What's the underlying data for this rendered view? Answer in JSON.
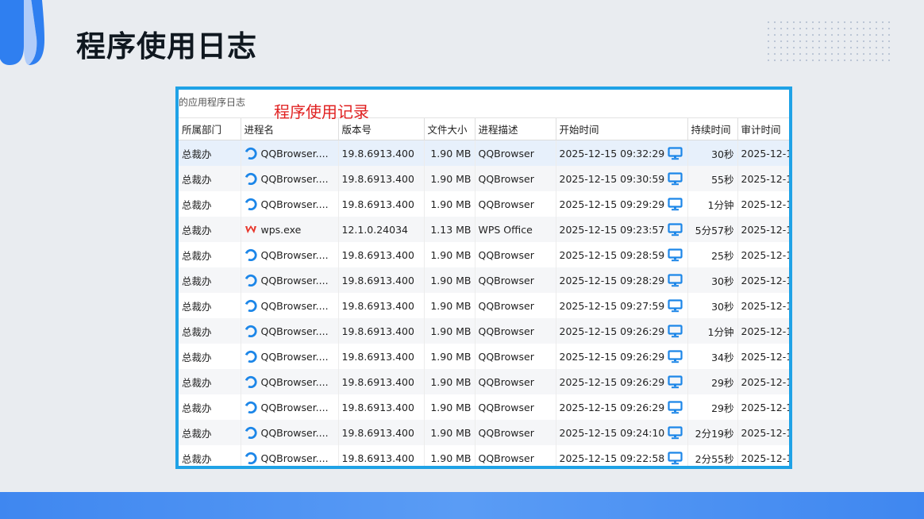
{
  "slide": {
    "title": "程序使用日志"
  },
  "window": {
    "title": "的应用程序日志",
    "annotation": "程序使用记录"
  },
  "table": {
    "columns": [
      "所属部门",
      "进程名",
      "版本号",
      "文件大小",
      "进程描述",
      "开始时间",
      "持续时间",
      "审计时间"
    ],
    "rows": [
      {
        "dept": "总裁办",
        "icon": "qqbrowser-icon",
        "process": "QQBrowser....",
        "version": "19.8.6913.400",
        "size": "1.90 MB",
        "desc": "QQBrowser",
        "start": "2025-12-15 09:32:29",
        "duration": "30秒",
        "audit": "2025-12-1"
      },
      {
        "dept": "总裁办",
        "icon": "qqbrowser-icon",
        "process": "QQBrowser....",
        "version": "19.8.6913.400",
        "size": "1.90 MB",
        "desc": "QQBrowser",
        "start": "2025-12-15 09:30:59",
        "duration": "55秒",
        "audit": "2025-12-1"
      },
      {
        "dept": "总裁办",
        "icon": "qqbrowser-icon",
        "process": "QQBrowser....",
        "version": "19.8.6913.400",
        "size": "1.90 MB",
        "desc": "QQBrowser",
        "start": "2025-12-15 09:29:29",
        "duration": "1分钟",
        "audit": "2025-12-1"
      },
      {
        "dept": "总裁办",
        "icon": "wps-icon",
        "process": "wps.exe",
        "version": "12.1.0.24034",
        "size": "1.13 MB",
        "desc": "WPS Office",
        "start": "2025-12-15 09:23:57",
        "duration": "5分57秒",
        "audit": "2025-12-1"
      },
      {
        "dept": "总裁办",
        "icon": "qqbrowser-icon",
        "process": "QQBrowser....",
        "version": "19.8.6913.400",
        "size": "1.90 MB",
        "desc": "QQBrowser",
        "start": "2025-12-15 09:28:59",
        "duration": "25秒",
        "audit": "2025-12-1"
      },
      {
        "dept": "总裁办",
        "icon": "qqbrowser-icon",
        "process": "QQBrowser....",
        "version": "19.8.6913.400",
        "size": "1.90 MB",
        "desc": "QQBrowser",
        "start": "2025-12-15 09:28:29",
        "duration": "30秒",
        "audit": "2025-12-1"
      },
      {
        "dept": "总裁办",
        "icon": "qqbrowser-icon",
        "process": "QQBrowser....",
        "version": "19.8.6913.400",
        "size": "1.90 MB",
        "desc": "QQBrowser",
        "start": "2025-12-15 09:27:59",
        "duration": "30秒",
        "audit": "2025-12-1"
      },
      {
        "dept": "总裁办",
        "icon": "qqbrowser-icon",
        "process": "QQBrowser....",
        "version": "19.8.6913.400",
        "size": "1.90 MB",
        "desc": "QQBrowser",
        "start": "2025-12-15 09:26:29",
        "duration": "1分钟",
        "audit": "2025-12-1"
      },
      {
        "dept": "总裁办",
        "icon": "qqbrowser-icon",
        "process": "QQBrowser....",
        "version": "19.8.6913.400",
        "size": "1.90 MB",
        "desc": "QQBrowser",
        "start": "2025-12-15 09:26:29",
        "duration": "34秒",
        "audit": "2025-12-1"
      },
      {
        "dept": "总裁办",
        "icon": "qqbrowser-icon",
        "process": "QQBrowser....",
        "version": "19.8.6913.400",
        "size": "1.90 MB",
        "desc": "QQBrowser",
        "start": "2025-12-15 09:26:29",
        "duration": "29秒",
        "audit": "2025-12-1"
      },
      {
        "dept": "总裁办",
        "icon": "qqbrowser-icon",
        "process": "QQBrowser....",
        "version": "19.8.6913.400",
        "size": "1.90 MB",
        "desc": "QQBrowser",
        "start": "2025-12-15 09:26:29",
        "duration": "29秒",
        "audit": "2025-12-1"
      },
      {
        "dept": "总裁办",
        "icon": "qqbrowser-icon",
        "process": "QQBrowser....",
        "version": "19.8.6913.400",
        "size": "1.90 MB",
        "desc": "QQBrowser",
        "start": "2025-12-15 09:24:10",
        "duration": "2分19秒",
        "audit": "2025-12-1"
      },
      {
        "dept": "总裁办",
        "icon": "qqbrowser-icon",
        "process": "QQBrowser....",
        "version": "19.8.6913.400",
        "size": "1.90 MB",
        "desc": "QQBrowser",
        "start": "2025-12-15 09:22:58",
        "duration": "2分55秒",
        "audit": "2025-12-1"
      }
    ]
  },
  "colors": {
    "frame": "#1fa2e6",
    "accent": "#1c86e8",
    "annotation": "#e02020",
    "selected_row": "#e7f0fb"
  }
}
